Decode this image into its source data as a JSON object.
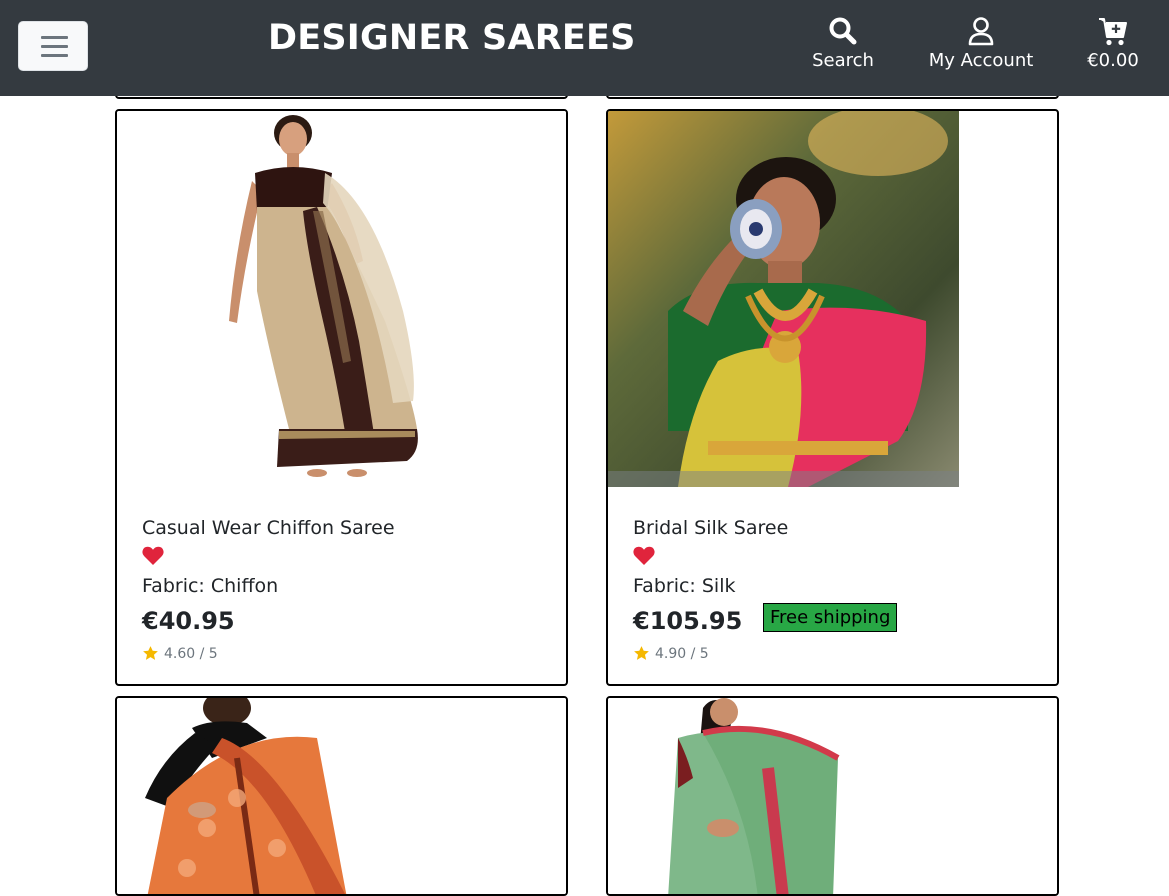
{
  "header": {
    "brand": "DESIGNER SAREES",
    "search_label": "Search",
    "account_label": "My Account",
    "cart_total": "€0.00",
    "bg_color": "#343a40"
  },
  "products": [
    {
      "name": "Casual Wear Chiffon Saree",
      "fabric": "Fabric: Chiffon",
      "price": "€40.95",
      "rating": "4.60 / 5",
      "favorite": true
    },
    {
      "name": "Bridal Silk Saree",
      "fabric": "Fabric: Silk",
      "price": "€105.95",
      "badge": "Free shipping",
      "rating": "4.90 / 5",
      "favorite": true
    }
  ],
  "colors": {
    "heart": "#e0243c",
    "star": "#f5b800",
    "badge": "#28a745"
  }
}
